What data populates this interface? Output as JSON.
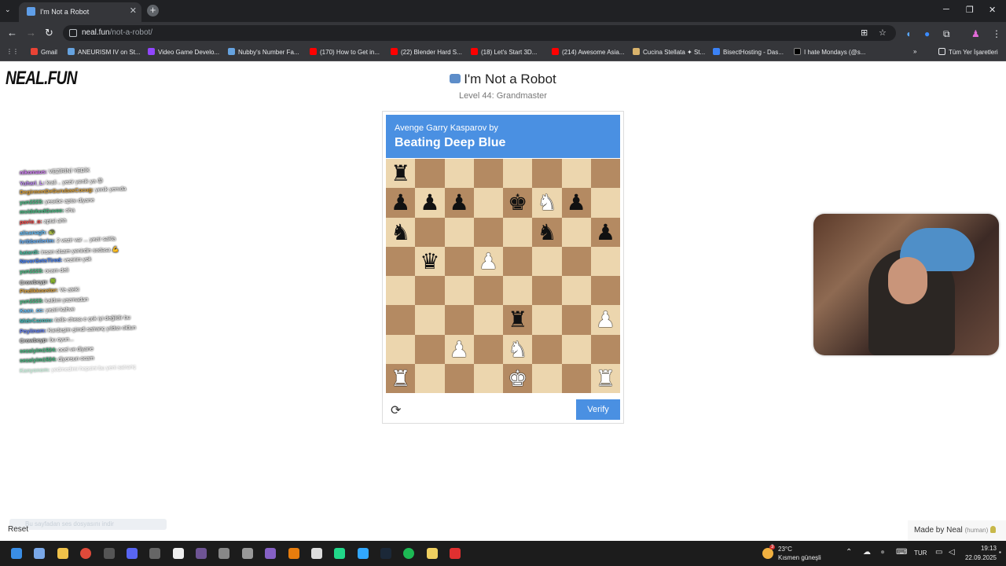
{
  "browser": {
    "tab_title": "I'm Not a Robot",
    "tab_close": "✕",
    "new_tab": "+",
    "url_domain": "neal.fun",
    "url_path": "/not-a-robot/",
    "bookmarks": [
      {
        "label": "Gmail",
        "color": "#ea4335"
      },
      {
        "label": "ANEURISM IV on St...",
        "color": "#66a3e0"
      },
      {
        "label": "Video Game Develo...",
        "color": "#9146ff"
      },
      {
        "label": "Nubby's Number Fa...",
        "color": "#66a3e0"
      },
      {
        "label": "(170) How to Get in...",
        "color": "#ff0000"
      },
      {
        "label": "(22) Blender Hard S...",
        "color": "#ff0000"
      },
      {
        "label": "(18) Let's Start 3D...",
        "color": "#ff0000"
      },
      {
        "label": "(214) Awesome Asia...",
        "color": "#ff0000"
      },
      {
        "label": "Cucina Stellata ✦ St...",
        "color": "#d9b36c"
      },
      {
        "label": "BisectHosting - Das...",
        "color": "#3b82f6"
      },
      {
        "label": "I hate Mondays (@s...",
        "color": "#000000"
      }
    ],
    "all_bookmarks": "Tüm Yer İşaretleri"
  },
  "page": {
    "logo": "NEAL.FUN",
    "title": "I'm Not a Robot",
    "level": "Level 44: Grandmaster"
  },
  "challenge": {
    "prompt_small": "Avenge Garry Kasparov by",
    "prompt_big": "Beating Deep Blue",
    "verify_label": "Verify",
    "refresh_icon": "⟳",
    "board": [
      [
        "bR",
        "",
        "",
        "",
        "",
        "",
        "",
        ""
      ],
      [
        "bP",
        "bP",
        "bP",
        "",
        "bK",
        "wN",
        "bP",
        ""
      ],
      [
        "bN",
        "",
        "",
        "",
        "",
        "bN",
        "",
        "bP"
      ],
      [
        "",
        "bQ",
        "",
        "wP",
        "",
        "",
        "",
        ""
      ],
      [
        "",
        "",
        "",
        "",
        "",
        "",
        "",
        ""
      ],
      [
        "",
        "",
        "",
        "",
        "bR",
        "",
        "",
        "wP"
      ],
      [
        "",
        "",
        "wP",
        "",
        "wN",
        "",
        "",
        ""
      ],
      [
        "wR",
        "",
        "",
        "",
        "wK",
        "",
        "",
        "wR"
      ]
    ]
  },
  "chat": [
    {
      "user": "nikomaus",
      "msg": "VEZİRİNİ YEDİK",
      "color": "#d77cff"
    },
    {
      "user": "Yuhari_L",
      "msg": "krali  .. yezir yenik ya 😡",
      "color": "#c48cff"
    },
    {
      "user": "DegirmenDeGurubasCocug",
      "msg": "yenik yenıda",
      "color": "#e0a030"
    },
    {
      "user": "yun2223",
      "msg": "yesebe aptaı diyane",
      "color": "#40c080"
    },
    {
      "user": "mvidehedGuvee",
      "msg": "oha",
      "color": "#40c080"
    },
    {
      "user": "pavio_o",
      "msg": "aptal ahh",
      "color": "#ff4040"
    },
    {
      "user": "alisanagh",
      "msg": "🐢",
      "color": "#60c0ff"
    },
    {
      "user": "hrtbbenlerim",
      "msg": "2 vezir var ... yezir sakla",
      "color": "#60b0ff"
    },
    {
      "user": "katardi",
      "msg": "insan olsam yenirdin sodasa 💪",
      "color": "#40c0a0"
    },
    {
      "user": "NeverGetsTired",
      "msg": "vezirim yok",
      "color": "#4080ff"
    },
    {
      "user": "yun2223",
      "msg": "ocam deli",
      "color": "#40c080"
    },
    {
      "user": "Crowbeyp",
      "msg": "🍀",
      "color": "#c0c0c0"
    },
    {
      "user": "Pindikkoostor",
      "msg": "Ve ateki",
      "color": "#e0a030"
    },
    {
      "user": "yun2223",
      "msg": "kaldım yazmadan",
      "color": "#40c080"
    },
    {
      "user": "Kaan_cc",
      "msg": "yeziri kahve",
      "color": "#60c0ff"
    },
    {
      "user": "MideCazozu",
      "msg": "itelle chess e çok iyi değildir bu",
      "color": "#40c0c0"
    },
    {
      "user": "Poyitnam",
      "msg": "Kardeşim şimdi satranç yıldızı oldun",
      "color": "#6080ff"
    },
    {
      "user": "Crowbeyp",
      "msg": "bu oyun...",
      "color": "#c0c0c0"
    },
    {
      "user": "sezaiyim1924",
      "msg": "ocel ve diyane",
      "color": "#40c080"
    },
    {
      "user": "sezaiyim1924",
      "msg": "diyorsun ocam",
      "color": "#40c080"
    },
    {
      "user": "Kanyonom",
      "msg": "yedmedimi hepsini bu yeni satranç",
      "color": "#40c080"
    }
  ],
  "bottom": {
    "reset": "Reset",
    "download_bar": "Bu sayfadan ses dosyasını indir",
    "made_by": "Made by Neal",
    "human_tag": "(human)"
  },
  "taskbar": {
    "weather_temp": "23°C",
    "weather_desc": "Kısmen güneşli",
    "weather_alert": "3",
    "lang": "TUR",
    "time": "19:13",
    "date": "22.09.2025"
  }
}
